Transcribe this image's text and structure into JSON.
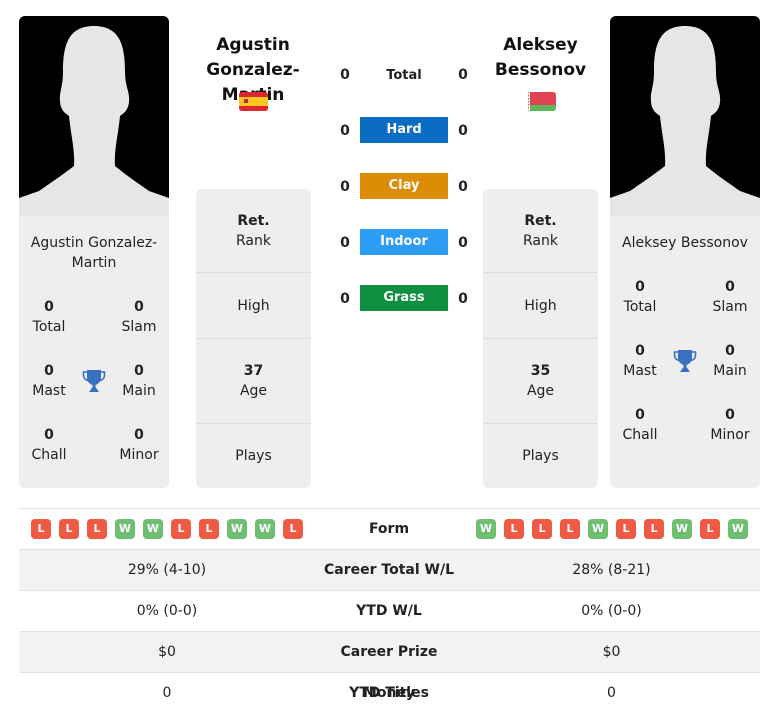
{
  "colors": {
    "hard": "#0b6cc4",
    "clay": "#dd8c06",
    "indoor": "#2c9cf4",
    "grass": "#0e9040",
    "win": "#6fbf73",
    "loss": "#ee5a44",
    "trophy": "#3a70c0"
  },
  "player1": {
    "name_line1": "Agustin",
    "name_line2": "Gonzalez-Martin",
    "card_name": "Agustin Gonzalez-Martin",
    "flag": "Spain",
    "stats": {
      "total": "0",
      "total_label": "Total",
      "slam": "0",
      "slam_label": "Slam",
      "mast": "0",
      "mast_label": "Mast",
      "main": "0",
      "main_label": "Main",
      "chall": "0",
      "chall_label": "Chall",
      "minor": "0",
      "minor_label": "Minor"
    },
    "rank_value": "Ret.",
    "rank_label": "Rank",
    "high_label": "High",
    "age_value": "37",
    "age_label": "Age",
    "plays_label": "Plays",
    "form": [
      "L",
      "L",
      "L",
      "W",
      "W",
      "L",
      "L",
      "W",
      "W",
      "L"
    ],
    "career_wl": "29% (4-10)",
    "ytd_wl": "0% (0-0)",
    "prize": "$0",
    "ytd_titles": "0"
  },
  "player2": {
    "name_line1": "Aleksey",
    "name_line2": "Bessonov",
    "card_name": "Aleksey Bessonov",
    "flag": "Belarus",
    "stats": {
      "total": "0",
      "total_label": "Total",
      "slam": "0",
      "slam_label": "Slam",
      "mast": "0",
      "mast_label": "Mast",
      "main": "0",
      "main_label": "Main",
      "chall": "0",
      "chall_label": "Chall",
      "minor": "0",
      "minor_label": "Minor"
    },
    "rank_value": "Ret.",
    "rank_label": "Rank",
    "high_label": "High",
    "age_value": "35",
    "age_label": "Age",
    "plays_label": "Plays",
    "form": [
      "W",
      "L",
      "L",
      "L",
      "W",
      "L",
      "L",
      "W",
      "L",
      "W"
    ],
    "career_wl": "28% (8-21)",
    "ytd_wl": "0% (0-0)",
    "prize": "$0",
    "ytd_titles": "0"
  },
  "surfaces": [
    {
      "label": "Total",
      "p1": "0",
      "p2": "0"
    },
    {
      "label": "Hard",
      "p1": "0",
      "p2": "0"
    },
    {
      "label": "Clay",
      "p1": "0",
      "p2": "0"
    },
    {
      "label": "Indoor",
      "p1": "0",
      "p2": "0"
    },
    {
      "label": "Grass",
      "p1": "0",
      "p2": "0"
    }
  ],
  "comparison": {
    "form_label": "Form",
    "career_wl_label": "Career Total W/L",
    "ytd_wl_label": "YTD W/L",
    "prize_label": "Career Prize Money",
    "ytd_titles_label": "YTD Titles"
  }
}
